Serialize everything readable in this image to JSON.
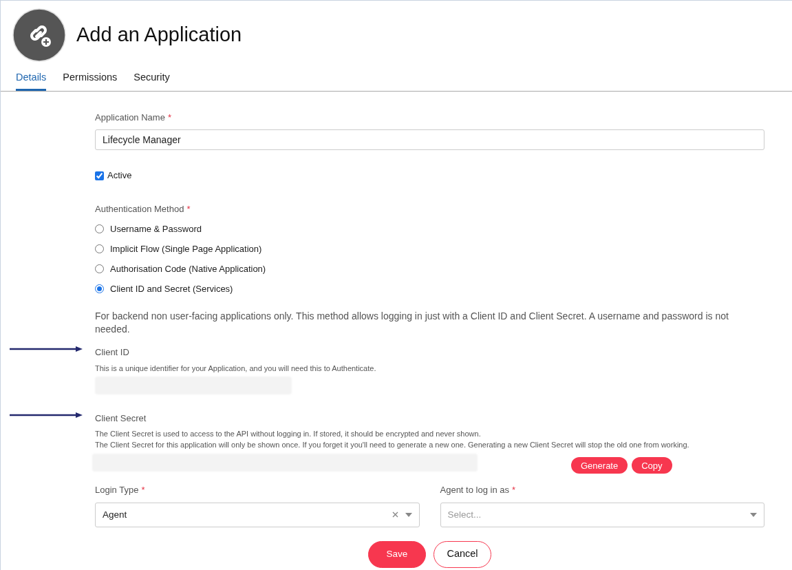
{
  "header": {
    "title": "Add an Application"
  },
  "tabs": [
    {
      "label": "Details",
      "selected": true
    },
    {
      "label": "Permissions",
      "selected": false
    },
    {
      "label": "Security",
      "selected": false
    }
  ],
  "application_name": {
    "label": "Application Name",
    "required": "*",
    "value": "Lifecycle Manager"
  },
  "active": {
    "label": "Active",
    "checked": true
  },
  "authentication_method": {
    "label": "Authentication Method",
    "required": "*",
    "options": [
      {
        "label": "Username & Password",
        "selected": false
      },
      {
        "label": "Implicit Flow (Single Page Application)",
        "selected": false
      },
      {
        "label": "Authorisation Code (Native Application)",
        "selected": false
      },
      {
        "label": "Client ID and Secret (Services)",
        "selected": true
      }
    ],
    "description": "For backend non user-facing applications only. This method allows logging in just with a Client ID and Client Secret. A username and password is not needed."
  },
  "client_id": {
    "label": "Client ID",
    "help": [
      "This is a unique identifier for your Application, and you will need this to Authenticate."
    ]
  },
  "client_secret": {
    "label": "Client Secret",
    "help": [
      "The Client Secret is used to access to the API without logging in. If stored, it should be encrypted and never shown.",
      "The Client Secret for this application will only be shown once. If you forget it you'll need to generate a new one. Generating a new Client Secret will stop the old one from working."
    ],
    "buttons": [
      "Generate",
      "Copy"
    ]
  },
  "login_type": {
    "label": "Login Type",
    "required": "*",
    "value": "Agent"
  },
  "agent": {
    "label": "Agent to log in as",
    "required": "*",
    "placeholder": "Select..."
  },
  "buttons": [
    {
      "label": "Save",
      "kind": "primary"
    },
    {
      "label": "Cancel",
      "kind": "secondary"
    }
  ]
}
